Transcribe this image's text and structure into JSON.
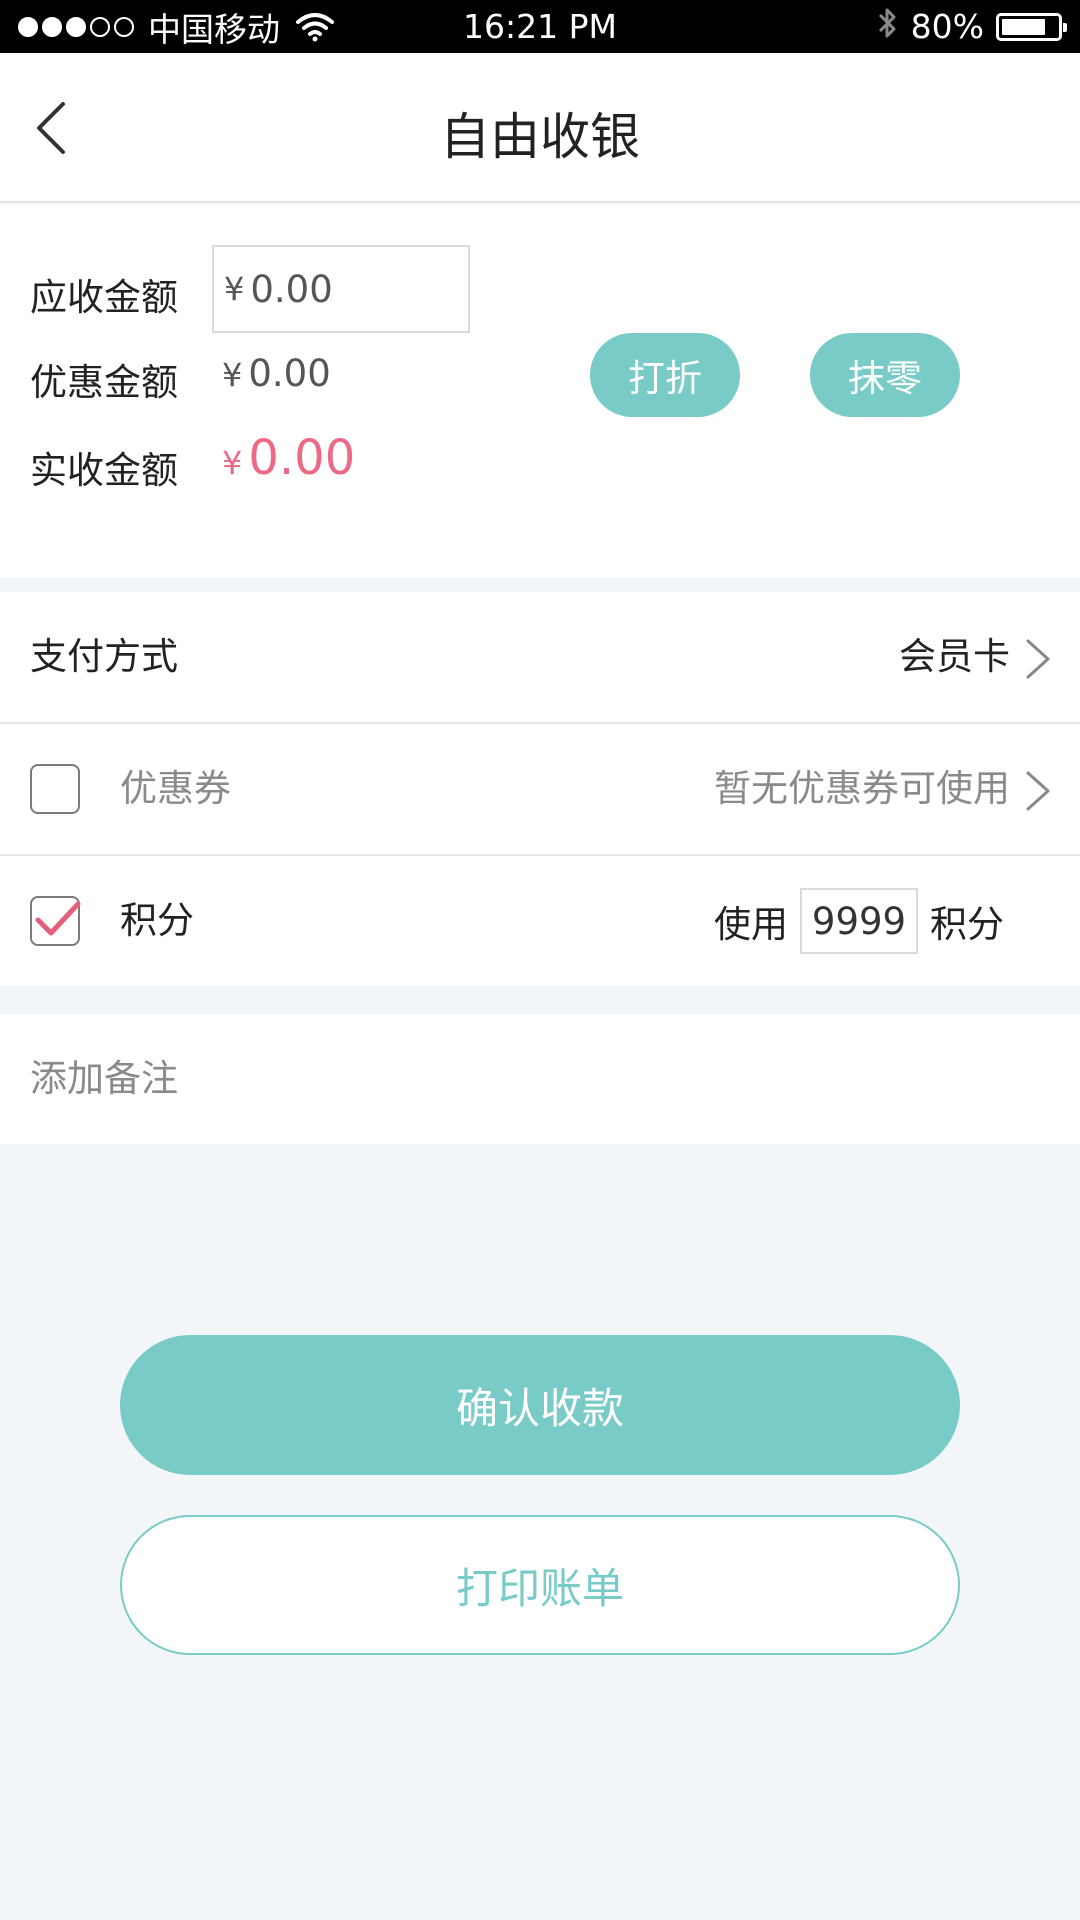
{
  "status_bar": {
    "signal_filled": 3,
    "signal_total": 5,
    "carrier": "中国移动",
    "time": "16:21 PM",
    "battery_text": "80%",
    "battery_level": 0.8
  },
  "header": {
    "back_icon": "chevron-left-icon",
    "title": "自由收银"
  },
  "amounts": {
    "receivable_label": "应收金额",
    "receivable_value": "0.00",
    "discount_label": "优惠金额",
    "discount_value": "0.00",
    "actual_label": "实收金额",
    "actual_value": "0.00",
    "currency_symbol": "¥",
    "discount_button": "打折",
    "round_button": "抹零"
  },
  "payment": {
    "label": "支付方式",
    "value": "会员卡"
  },
  "coupon": {
    "checked": false,
    "label": "优惠券",
    "status": "暂无优惠券可使用"
  },
  "points": {
    "checked": true,
    "label": "积分",
    "use_prefix": "使用",
    "value": "9999",
    "use_suffix": "积分"
  },
  "note": {
    "placeholder": "添加备注"
  },
  "actions": {
    "confirm": "确认收款",
    "print": "打印账单"
  },
  "colors": {
    "accent": "#79cbc8",
    "price_red": "#ec6a85",
    "check_red": "#e4607a"
  }
}
